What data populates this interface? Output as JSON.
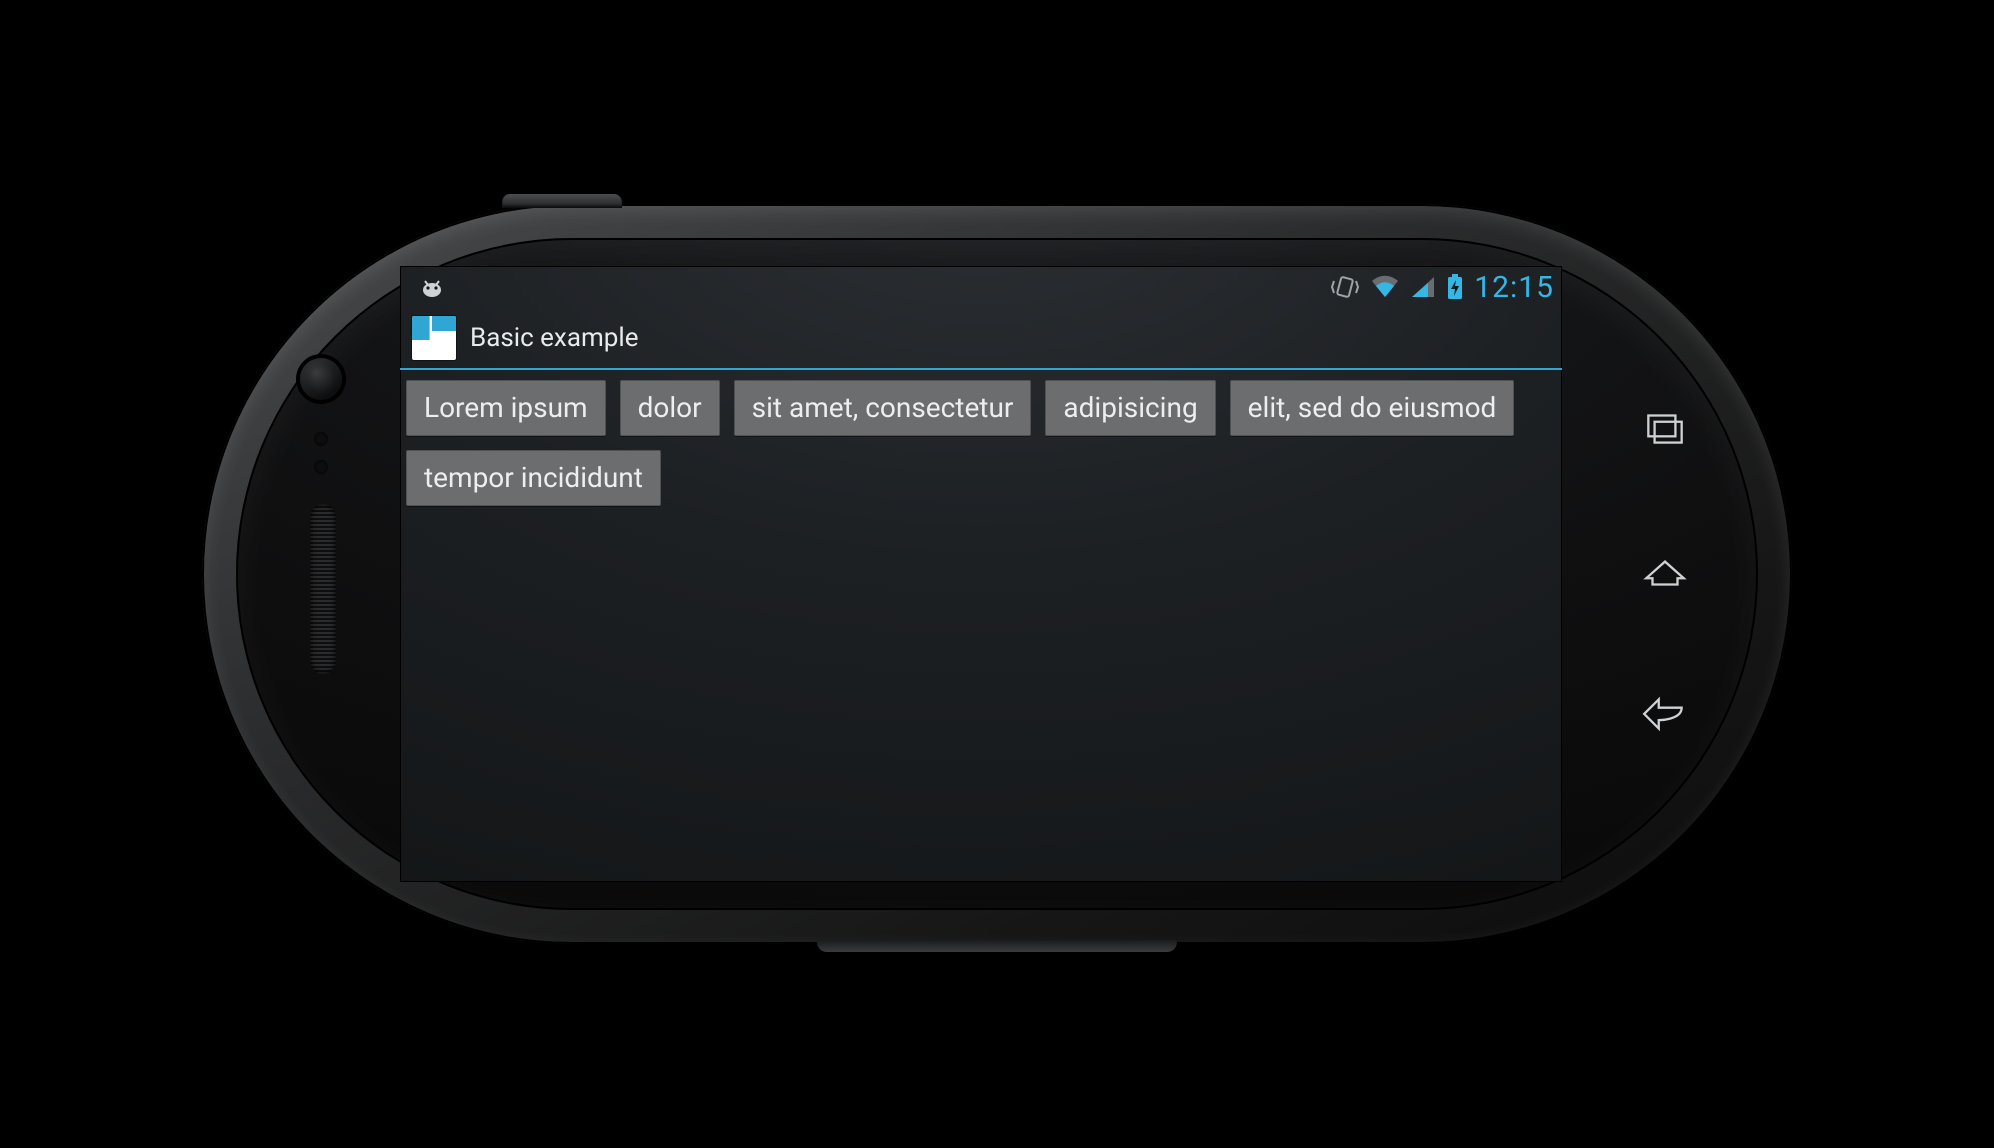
{
  "statusbar": {
    "time": "12:15",
    "icons": {
      "debug": "android-debug-icon",
      "vibrate": "vibrate-icon",
      "wifi": "wifi-icon",
      "signal": "signal-icon",
      "battery": "battery-charging-icon"
    }
  },
  "actionbar": {
    "title": "Basic example",
    "icon": "app-icon"
  },
  "tags": [
    "Lorem ipsum",
    "dolor",
    "sit amet, consectetur",
    "adipisicing",
    "elit, sed do eiusmod",
    "tempor incididunt"
  ],
  "nav": {
    "recent": "recent-apps-icon",
    "home": "home-icon",
    "back": "back-icon"
  }
}
